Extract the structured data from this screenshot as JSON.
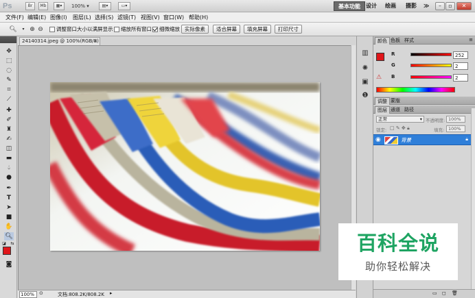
{
  "appbar": {
    "logo": "Ps",
    "zoom": "100%",
    "workspaces": [
      "基本功能",
      "设计",
      "绘画",
      "摄影"
    ],
    "more": "≫"
  },
  "menu": [
    "文件(F)",
    "编辑(E)",
    "图像(I)",
    "图层(L)",
    "选择(S)",
    "滤镜(T)",
    "视图(V)",
    "窗口(W)",
    "帮助(H)"
  ],
  "options": {
    "checks": [
      {
        "label": "调整窗口大小以满屏显示",
        "checked": false
      },
      {
        "label": "缩放所有窗口",
        "checked": false
      },
      {
        "label": "细微缩放",
        "checked": true
      }
    ],
    "buttons": [
      "实际像素",
      "适合屏幕",
      "填充屏幕",
      "打印尺寸"
    ]
  },
  "document": {
    "tab": "24140314.jpeg @ 100%(RGB/8)",
    "zoom": "100%",
    "doc_size": "文档:808.2K/808.2K"
  },
  "color_panel": {
    "tabs": [
      "颜色",
      "色板",
      "样式"
    ],
    "channels": [
      {
        "label": "R",
        "value": "252"
      },
      {
        "label": "G",
        "value": "2"
      },
      {
        "label": "B",
        "value": "2"
      }
    ],
    "foreground": "#e0161a"
  },
  "adjust_panel": {
    "tabs": [
      "调整",
      "蒙版"
    ]
  },
  "layers_panel": {
    "tabs": [
      "图层",
      "通道",
      "路径"
    ],
    "blend_mode": "正常",
    "opacity_label": "不透明度:",
    "opacity": "100%",
    "lock_label": "锁定:",
    "fill_label": "填充:",
    "fill": "100%",
    "layer_name": "背景"
  },
  "watermark": {
    "title": "百科全说",
    "subtitle": "助你轻松解决"
  }
}
